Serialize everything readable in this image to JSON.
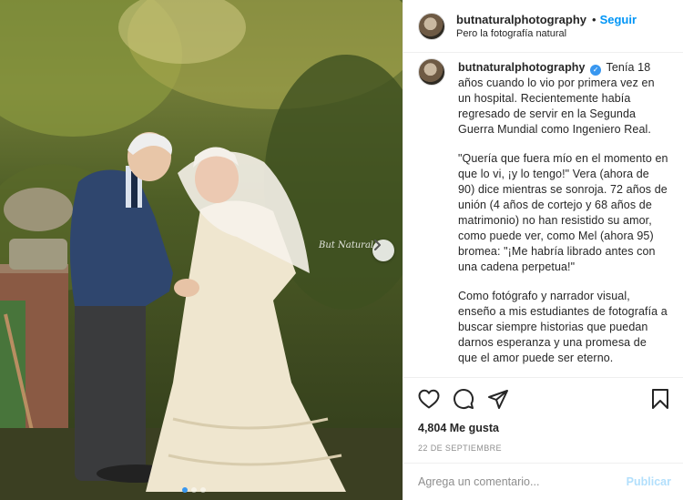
{
  "post": {
    "username": "butnaturalphotography",
    "follow_label": "Seguir",
    "location": "Pero la fotografía natural",
    "separator": "•",
    "watermark": "But Natural",
    "caption_paragraphs": [
      "Tenía 18 años cuando lo vio por primera vez en un hospital. Recientemente había regresado de servir en la Segunda Guerra Mundial como Ingeniero Real.",
      "\"Quería que fuera mío en el momento en que lo vi, ¡y lo tengo!\" Vera (ahora de 90) dice mientras se sonroja. 72 años de unión (4 años de cortejo y 68 años de matrimonio) no han resistido su amor, como puede ver, como Mel (ahora 95) bromea: \"¡Me habría librado antes con una cadena perpetua!\"",
      "Como fotógrafo y narrador visual, enseño a mis estudiantes de fotografía a buscar siempre historias que puedan darnos esperanza y una promesa de que el amor puede ser eterno."
    ],
    "likes": "4,804 Me gusta",
    "date": "22 DE SEPTIEMBRE",
    "carousel": {
      "total": 3,
      "current": 1
    }
  },
  "comment": {
    "placeholder": "Agrega un comentario...",
    "publish_label": "Publicar"
  },
  "colors": {
    "accent": "#0095f6",
    "publish_disabled": "#b2dffc",
    "verified": "#3897f0"
  },
  "icons": [
    "heart-icon",
    "comment-icon",
    "share-icon",
    "bookmark-icon",
    "chevron-right-icon",
    "verified-badge-icon"
  ]
}
